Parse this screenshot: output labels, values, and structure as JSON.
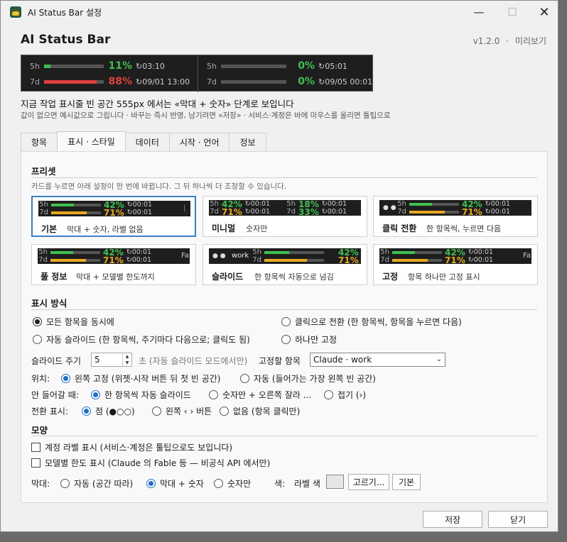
{
  "window": {
    "title": "AI Status Bar 설정",
    "minimize": "—",
    "maximize": "☐",
    "close": "✕"
  },
  "header": {
    "app_title": "AI Status Bar",
    "version": "v1.2.0",
    "separator": "·",
    "preview_link": "미리보기"
  },
  "preview": {
    "left": [
      {
        "label": "5h",
        "pct": "11%",
        "fill": 0.11,
        "reset": "03:10",
        "color": "#3fc04f"
      },
      {
        "label": "7d",
        "pct": "88%",
        "fill": 0.88,
        "reset": "09/01 13:00",
        "color": "#e04040"
      }
    ],
    "right": [
      {
        "label": "5h",
        "pct": "0%",
        "fill": 0.0,
        "reset": "05:01",
        "color": "#3fc04f"
      },
      {
        "label": "7d",
        "pct": "0%",
        "fill": 0.0,
        "reset": "09/05 00:01",
        "color": "#3fc04f"
      }
    ]
  },
  "description": {
    "line1": "지금 작업 표시줄 빈 공간 555px 에서는 «막대 + 숫자» 단계로 보입니다",
    "line2": "값이 없으면 예시값으로 그립니다 · 바꾸는 즉시 반영, 남기려면 «저장» · 서비스·계정은 바에 마우스를 올리면 툴팁으로"
  },
  "tabs": [
    {
      "label": "항목",
      "active": false
    },
    {
      "label": "표시 · 스타일",
      "active": true
    },
    {
      "label": "데이터",
      "active": false
    },
    {
      "label": "시작 · 언어",
      "active": false
    },
    {
      "label": "정보",
      "active": false
    }
  ],
  "presets": {
    "title": "프리셋",
    "hint": "카드를 누르면 아래 설정이 한 번에 바뀝니다. 그 뒤 하나씩 더 조정할 수 있습니다.",
    "sample": {
      "l5": "5h",
      "l7": "7d",
      "p5": "42%",
      "p7": "71%",
      "r5": "00:01",
      "r7": "00:01",
      "alt_p5": "18%",
      "alt_p7": "33%",
      "fa": "Fa",
      "work": "work",
      "pipe": "|"
    },
    "cards": [
      {
        "name": "기본",
        "sub": "막대 + 숫자, 라벨 없음"
      },
      {
        "name": "미니멀",
        "sub": "숫자만"
      },
      {
        "name": "클릭 전환",
        "sub": "한 항목씩, 누르면 다음"
      },
      {
        "name": "풀 정보",
        "sub": "막대 + 모델별 한도까지"
      },
      {
        "name": "슬라이드",
        "sub": "한 항목씩 자동으로 넘김"
      },
      {
        "name": "고정",
        "sub": "항목 하나만 고정 표시"
      }
    ]
  },
  "display_mode": {
    "title": "표시 방식",
    "options": {
      "all": "모든 항목을 동시에",
      "click": "클릭으로 전환 (한 항목씩, 항목을 누르면 다음)",
      "auto": "자동 슬라이드 (한 항목씩, 주기마다 다음으로; 클릭도 됨)",
      "fixed": "하나만 고정"
    },
    "slide_label": "슬라이드 주기",
    "slide_value": "5",
    "slide_unit": "초 (자동 슬라이드 모드에서만)",
    "fixed_label": "고정할 항목",
    "fixed_value": "Claude · work",
    "position_label": "위치:",
    "position_left": "왼쪽 고정 (위젯·시작 버튼 뒤 첫 빈 공간)",
    "position_auto": "자동 (들어가는 가장 왼쪽 빈 공간)",
    "overflow_label": "안 들어갈 때:",
    "overflow_slide": "한 항목씩 자동 슬라이드",
    "overflow_numbers": "숫자만 + 오른쪽 잘라 ...",
    "overflow_fold": "접기 (›)",
    "switch_label": "전환 표시:",
    "switch_dots": "점 (●○○)",
    "switch_arrows": "왼쪽 ‹ › 버튼",
    "switch_none": "없음 (항목 클릭만)"
  },
  "appearance": {
    "title": "모양",
    "account_label": "계정 라벨 표시 (서비스·계정은 툴팁으로도 보입니다)",
    "model_limit": "모델별 한도 표시 (Claude 의 Fable 등 — 비공식 API 에서만)",
    "bar_label": "막대:",
    "bar_auto": "자동 (공간 따라)",
    "bar_both": "막대 + 숫자",
    "bar_numbers": "숫자만",
    "color_label": "색:",
    "label_color": "라벨 색",
    "label_color_value": "#e6e6e6",
    "choose": "고르기...",
    "default": "기본"
  },
  "footer": {
    "save": "저장",
    "close": "닫기"
  },
  "colors": {
    "green": "#3fc04f",
    "orange": "#e8a820",
    "red": "#e04040",
    "accent": "#1f6fc5"
  }
}
